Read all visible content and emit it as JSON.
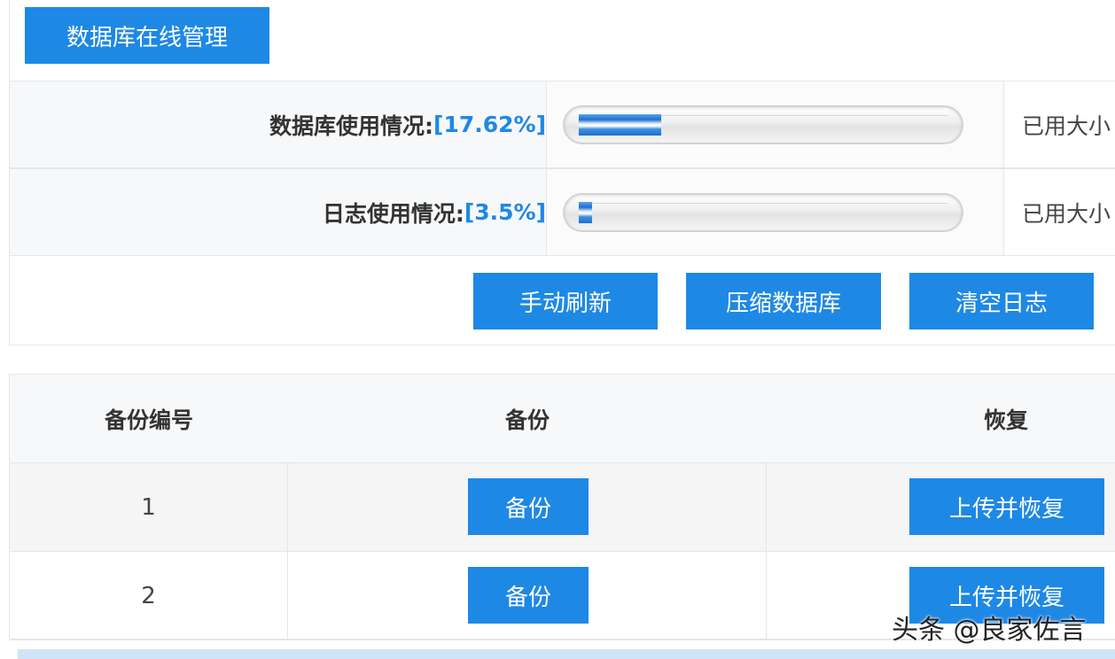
{
  "header": {
    "title_button": "数据库在线管理"
  },
  "usage": {
    "db": {
      "label": "数据库使用情况:",
      "percent_text": "[17.62%]",
      "fraction": 0.1762,
      "size_label": "已用大小"
    },
    "log": {
      "label": "日志使用情况:",
      "percent_text": "[3.5%]",
      "fraction": 0.035,
      "size_label": "已用大小"
    }
  },
  "actions": {
    "refresh": "手动刷新",
    "compress": "压缩数据库",
    "clear_log": "清空日志"
  },
  "backup_table": {
    "headers": [
      "备份编号",
      "备份",
      "恢复"
    ],
    "rows": [
      {
        "number": "1",
        "backup_label": "备份",
        "restore_label": "上传并恢复"
      },
      {
        "number": "2",
        "backup_label": "备份",
        "restore_label": "上传并恢复"
      }
    ]
  },
  "watermark": "头条 @良家佐言",
  "colors": {
    "accent": "#1e88e5",
    "percent_text": "#1e88e5"
  }
}
